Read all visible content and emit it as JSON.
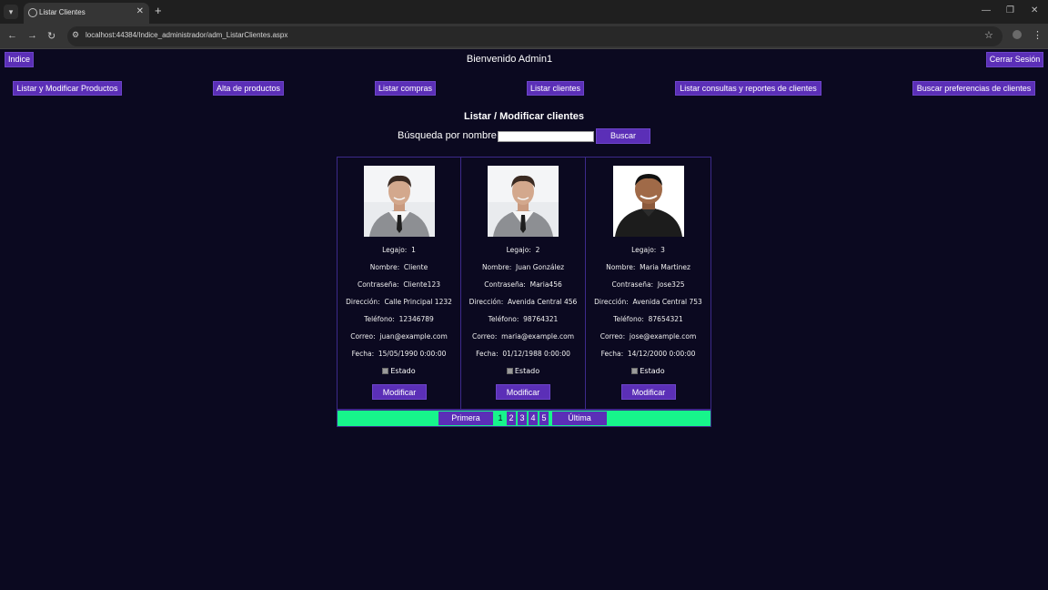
{
  "browser": {
    "tab_title": "Listar Clientes",
    "url": "localhost:44384/Indice_administrador/adm_ListarClientes.aspx"
  },
  "header": {
    "index_label": "Indice",
    "welcome": "Bienvenido Admin1",
    "logout_label": "Cerrar Sesión"
  },
  "menu": [
    {
      "label": "Listar y Modificar Productos"
    },
    {
      "label": "Alta de productos"
    },
    {
      "label": "Listar compras"
    },
    {
      "label": "Listar clientes"
    },
    {
      "label": "Listar consultas y reportes de clientes"
    },
    {
      "label": "Buscar preferencias de clientes"
    }
  ],
  "main": {
    "title": "Listar / Modificar clientes",
    "search_label": "Búsqueda por nombre",
    "search_value": "",
    "search_button": "Buscar"
  },
  "clients": [
    {
      "legajo": "Legajo:  1",
      "nombre": "Nombre:  Cliente",
      "contrasena": "Contraseña:  Cliente123",
      "direccion": "Dirección:  Calle Principal 1232",
      "telefono": "Teléfono:  12346789",
      "correo": "Correo:  juan@example.com",
      "fecha": "Fecha:  15/05/1990 0:00:00",
      "estado": "Estado",
      "button": "Modificar",
      "photo": "man-in-sweater-photo"
    },
    {
      "legajo": "Legajo:  2",
      "nombre": "Nombre:  Juan González",
      "contrasena": "Contraseña:  Maria456",
      "direccion": "Dirección:  Avenida Central 456",
      "telefono": "Teléfono:  98764321",
      "correo": "Correo:  maria@example.com",
      "fecha": "Fecha:  01/12/1988 0:00:00",
      "estado": "Estado",
      "button": "Modificar",
      "photo": "man-in-sweater-photo"
    },
    {
      "legajo": "Legajo:  3",
      "nombre": "Nombre:  Maria Martinez",
      "contrasena": "Contraseña:  Jose325",
      "direccion": "Dirección:  Avenida Central 753",
      "telefono": "Teléfono:  87654321",
      "correo": "Correo:  jose@example.com",
      "fecha": "Fecha:  14/12/2000 0:00:00",
      "estado": "Estado",
      "button": "Modificar",
      "photo": "man-in-black-polo-photo"
    }
  ],
  "pager": {
    "first": "Primera",
    "last": "Última",
    "pages": [
      "1",
      "2",
      "3",
      "4",
      "5"
    ],
    "current": "1"
  },
  "colors": {
    "background": "#0b0920",
    "button": "#5b2fb7",
    "pager_bar": "#17f58b"
  }
}
